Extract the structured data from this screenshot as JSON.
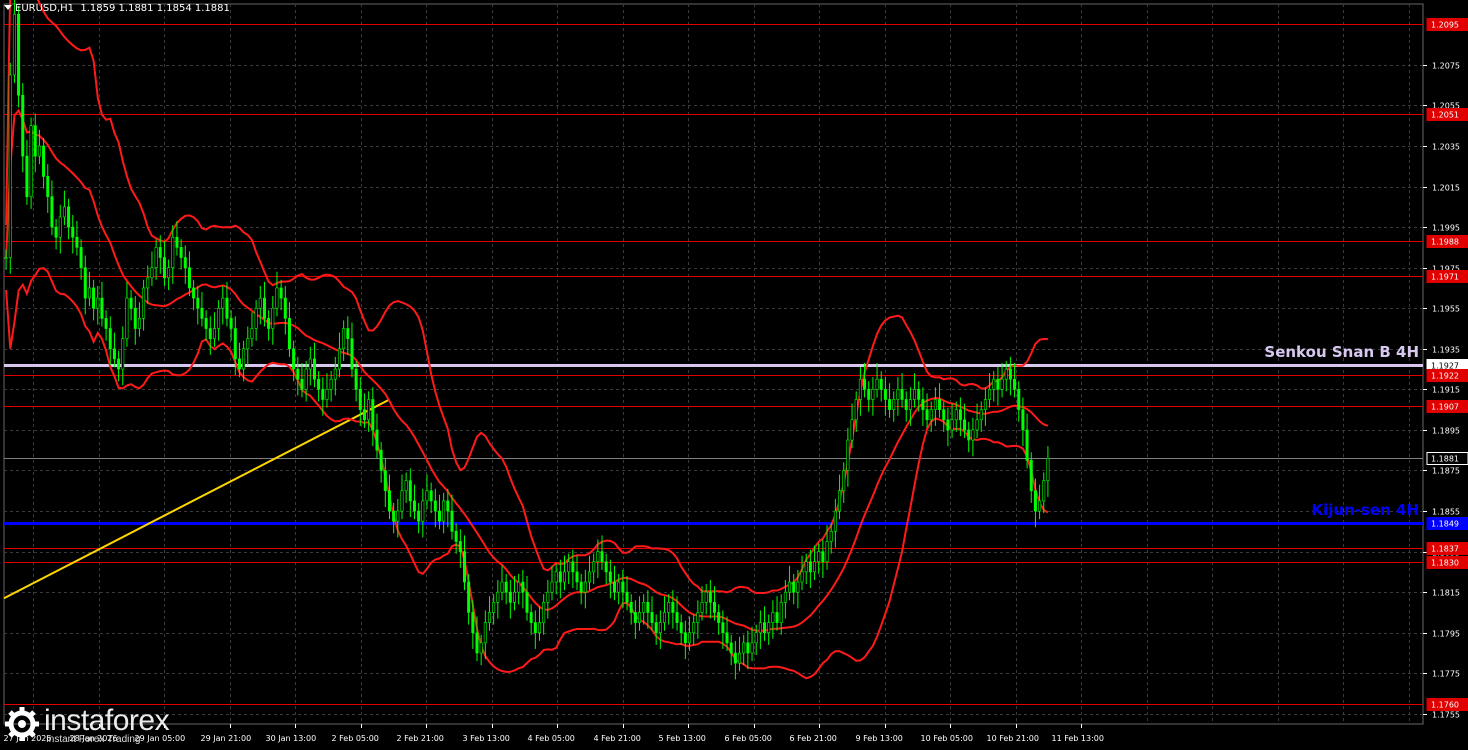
{
  "window": {
    "symbol_header": "EURUSD,H1  1.1859 1.1881 1.1854 1.1881"
  },
  "watermark": {
    "brand": "instaforex",
    "tagline": "Instant Forex Trading",
    "icon": "gear-icon"
  },
  "colors": {
    "background": "#000000",
    "grid": "#3a3a3a",
    "candle_up": "#00ff00",
    "candle_down": "#00ff00",
    "indicator": "#ff1a1a",
    "level_red": "#e00000",
    "kijun": "#0000ff",
    "senkou": "#d8c8f0",
    "trendline": "#ffd700",
    "current_price_line": "#808080"
  },
  "chart_data": {
    "type": "candlestick",
    "ylim": [
      1.175,
      1.2105
    ],
    "x_ticks": [
      "27 Jan 2026",
      "28 Jan 2026",
      "29 Jan 05:00",
      "29 Jan 21:00",
      "30 Jan 13:00",
      "2 Feb 05:00",
      "2 Feb 21:00",
      "3 Feb 13:00",
      "4 Feb 05:00",
      "4 Feb 21:00",
      "5 Feb 13:00",
      "6 Feb 05:00",
      "6 Feb 21:00",
      "9 Feb 13:00",
      "10 Feb 05:00",
      "10 Feb 21:00",
      "11 Feb 13:00"
    ],
    "y_ticks": [
      1.2075,
      1.2055,
      1.2035,
      1.2015,
      1.1995,
      1.1975,
      1.1955,
      1.1935,
      1.1915,
      1.1895,
      1.1875,
      1.1855,
      1.1835,
      1.1815,
      1.1795,
      1.1775,
      1.1755
    ],
    "y_tick_labels": [
      "1.2075",
      "1.2055",
      "1.2035",
      "1.2015",
      "1.1995",
      "1.1975",
      "1.1955",
      "1.1935",
      "1.1915",
      "1.1895",
      "1.1875",
      "1.1855",
      "1.1835",
      "1.1815",
      "1.1795",
      "1.1775",
      "1.1755"
    ],
    "levels": [
      {
        "value": 1.2095,
        "label": "1.2095",
        "kind": "red"
      },
      {
        "value": 1.2051,
        "label": "1.2051",
        "kind": "red"
      },
      {
        "value": 1.1988,
        "label": "1.1988",
        "kind": "red"
      },
      {
        "value": 1.1971,
        "label": "1.1971",
        "kind": "red"
      },
      {
        "value": 1.1927,
        "label": "1.1927",
        "kind": "senkou"
      },
      {
        "value": 1.1922,
        "label": "1.1922",
        "kind": "red"
      },
      {
        "value": 1.1907,
        "label": "1.1907",
        "kind": "red"
      },
      {
        "value": 1.1881,
        "label": "1.1881",
        "kind": "current"
      },
      {
        "value": 1.1849,
        "label": "1.1849",
        "kind": "kijun"
      },
      {
        "value": 1.1837,
        "label": "1.1837",
        "kind": "red"
      },
      {
        "value": 1.183,
        "label": "1.1830",
        "kind": "red"
      },
      {
        "value": 1.176,
        "label": "1.1760",
        "kind": "red"
      }
    ],
    "annotations": [
      {
        "text": "Senkou Snan B 4H",
        "value": 1.1927,
        "color": "#d8c8f0"
      },
      {
        "text": "Kijun-sen 4H",
        "value": 1.1849,
        "color": "#0000ff"
      }
    ],
    "trendline": {
      "from_bar": 0,
      "from_value": 1.1812,
      "to_bar": 92,
      "to_value": 1.191
    },
    "series": [
      {
        "name": "Close",
        "values": [
          1.198,
          1.207,
          1.21,
          1.206,
          1.203,
          1.201,
          1.2045,
          1.203,
          1.2035,
          1.202,
          1.201,
          1.1995,
          1.199,
          1.2,
          1.2005,
          1.1995,
          1.199,
          1.1985,
          1.1975,
          1.196,
          1.1965,
          1.1955,
          1.196,
          1.195,
          1.1945,
          1.1935,
          1.193,
          1.1925,
          1.194,
          1.196,
          1.1955,
          1.1945,
          1.195,
          1.1965,
          1.197,
          1.1975,
          1.1985,
          1.198,
          1.197,
          1.1975,
          1.199,
          1.1985,
          1.198,
          1.1975,
          1.1965,
          1.196,
          1.1955,
          1.195,
          1.1945,
          1.194,
          1.1945,
          1.1955,
          1.196,
          1.195,
          1.1945,
          1.193,
          1.1925,
          1.1935,
          1.194,
          1.1945,
          1.1955,
          1.196,
          1.195,
          1.1945,
          1.1955,
          1.1965,
          1.196,
          1.195,
          1.1935,
          1.1925,
          1.192,
          1.1915,
          1.1925,
          1.193,
          1.192,
          1.1915,
          1.191,
          1.1915,
          1.192,
          1.1925,
          1.1935,
          1.1945,
          1.194,
          1.1925,
          1.1915,
          1.1905,
          1.19,
          1.191,
          1.1895,
          1.1885,
          1.1875,
          1.1865,
          1.1855,
          1.185,
          1.1855,
          1.1865,
          1.187,
          1.186,
          1.1855,
          1.185,
          1.186,
          1.1865,
          1.186,
          1.1855,
          1.185,
          1.186,
          1.1855,
          1.1845,
          1.184,
          1.1835,
          1.182,
          1.1805,
          1.1795,
          1.1785,
          1.179,
          1.18,
          1.1805,
          1.181,
          1.1815,
          1.182,
          1.1815,
          1.181,
          1.1815,
          1.182,
          1.1815,
          1.1805,
          1.18,
          1.1795,
          1.18,
          1.181,
          1.1815,
          1.182,
          1.1825,
          1.182,
          1.1825,
          1.183,
          1.1825,
          1.182,
          1.1815,
          1.182,
          1.1825,
          1.183,
          1.1835,
          1.183,
          1.1825,
          1.182,
          1.1815,
          1.182,
          1.1815,
          1.181,
          1.1805,
          1.18,
          1.1805,
          1.181,
          1.1805,
          1.18,
          1.1795,
          1.18,
          1.1805,
          1.181,
          1.1805,
          1.18,
          1.1795,
          1.179,
          1.1795,
          1.18,
          1.1805,
          1.181,
          1.1815,
          1.181,
          1.1805,
          1.18,
          1.1795,
          1.179,
          1.1785,
          1.178,
          1.1785,
          1.179,
          1.1785,
          1.179,
          1.1795,
          1.18,
          1.1795,
          1.18,
          1.1805,
          1.18,
          1.181,
          1.1815,
          1.182,
          1.1815,
          1.182,
          1.1825,
          1.183,
          1.1825,
          1.183,
          1.1835,
          1.183,
          1.184,
          1.1845,
          1.1855,
          1.1865,
          1.1875,
          1.189,
          1.19,
          1.191,
          1.192,
          1.1915,
          1.191,
          1.1915,
          1.192,
          1.1915,
          1.191,
          1.1905,
          1.191,
          1.1915,
          1.191,
          1.1905,
          1.191,
          1.1915,
          1.191,
          1.1905,
          1.19,
          1.1905,
          1.191,
          1.1905,
          1.19,
          1.1895,
          1.19,
          1.1905,
          1.19,
          1.1895,
          1.189,
          1.1895,
          1.19,
          1.1905,
          1.191,
          1.1915,
          1.192,
          1.1915,
          1.192,
          1.1925,
          1.192,
          1.1915,
          1.1905,
          1.1895,
          1.188,
          1.1865,
          1.1855,
          1.186,
          1.187,
          1.1881
        ]
      },
      {
        "name": "BB Upper",
        "values": []
      },
      {
        "name": "BB Middle",
        "values": []
      },
      {
        "name": "BB Lower",
        "values": []
      }
    ]
  }
}
